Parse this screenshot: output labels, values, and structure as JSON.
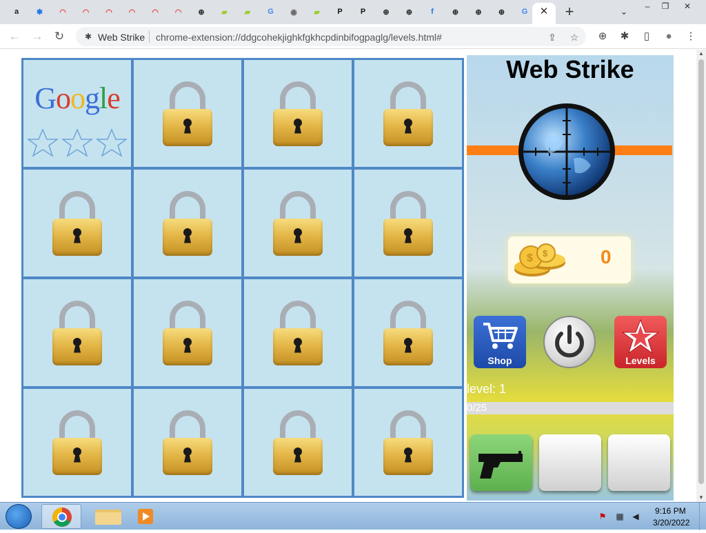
{
  "browser": {
    "active_tab_close": "✕",
    "new_tab": "+",
    "tab_search": "⌄",
    "window_controls": {
      "minimize": "–",
      "maximize": "❐",
      "close": "✕"
    },
    "tabs": [
      {
        "icon": "amazon-icon",
        "glyph": "a",
        "color": "#222"
      },
      {
        "icon": "extension-puzzle-icon",
        "glyph": "✱",
        "color": "#1a73e8"
      },
      {
        "icon": "rainbow-icon",
        "glyph": "◠",
        "color": "#e8453c"
      },
      {
        "icon": "rainbow-icon",
        "glyph": "◠",
        "color": "#e8453c"
      },
      {
        "icon": "rainbow-icon",
        "glyph": "◠",
        "color": "#e8453c"
      },
      {
        "icon": "rainbow-icon",
        "glyph": "◠",
        "color": "#e8453c"
      },
      {
        "icon": "rainbow-icon",
        "glyph": "◠",
        "color": "#e8453c"
      },
      {
        "icon": "rainbow-icon",
        "glyph": "◠",
        "color": "#e8453c"
      },
      {
        "icon": "crosshair-globe-icon",
        "glyph": "⊕",
        "color": "#222"
      },
      {
        "icon": "green-flag-icon",
        "glyph": "▰",
        "color": "#9ccc2a"
      },
      {
        "icon": "green-flag-icon",
        "glyph": "▰",
        "color": "#9ccc2a"
      },
      {
        "icon": "google-icon",
        "glyph": "G",
        "color": "#4285f4"
      },
      {
        "icon": "globe-icon",
        "glyph": "◉",
        "color": "#666"
      },
      {
        "icon": "green-flag-icon",
        "glyph": "▰",
        "color": "#9ccc2a"
      },
      {
        "icon": "p-icon",
        "glyph": "P",
        "color": "#111"
      },
      {
        "icon": "p-icon",
        "glyph": "P",
        "color": "#111"
      },
      {
        "icon": "crosshair-globe-icon",
        "glyph": "⊕",
        "color": "#222"
      },
      {
        "icon": "crosshair-globe-icon",
        "glyph": "⊕",
        "color": "#222"
      },
      {
        "icon": "facebook-icon",
        "glyph": "f",
        "color": "#1877f2"
      },
      {
        "icon": "crosshair-globe-icon",
        "glyph": "⊕",
        "color": "#222"
      },
      {
        "icon": "crosshair-globe-icon",
        "glyph": "⊕",
        "color": "#222"
      },
      {
        "icon": "crosshair-globe-icon",
        "glyph": "⊕",
        "color": "#222"
      },
      {
        "icon": "google-icon",
        "glyph": "G",
        "color": "#4285f4"
      }
    ],
    "back": "←",
    "forward": "→",
    "reload": "↻",
    "site_name": "Web Strike",
    "url": "chrome-extension://ddgcohekjighkfgkhcpdinbifogpaglg/levels.html#",
    "share_icon": "⇪",
    "bookmark_icon": "☆",
    "extension_icons": [
      "⊕",
      "✱"
    ],
    "sidepanel_icon": "▯",
    "profile_icon": "●",
    "menu_icon": "⋮"
  },
  "level_grid": {
    "first_cell": {
      "logo": "Google",
      "stars_earned": 0,
      "stars_total": 3
    },
    "locked_cells": 15
  },
  "game_panel": {
    "title": "Web Strike",
    "coins": "0",
    "shop_label": "Shop",
    "levels_label": "Levels",
    "level_text": "level: 1",
    "progress_text": "0/25",
    "progress_fraction": 0.0,
    "weapon_slots": [
      "pistol",
      "",
      ""
    ]
  },
  "taskbar": {
    "time": "9:16 PM",
    "date": "3/20/2022"
  },
  "colors": {
    "grid_border": "#4f88c6",
    "cell_bg": "#c5e3ef",
    "orange_bar": "#ff7f16",
    "coin_text": "#f28a1c",
    "shop_button": "#2b5fc4",
    "levels_button": "#d83a3f",
    "weapon_slot_active": "#6fc35c"
  }
}
